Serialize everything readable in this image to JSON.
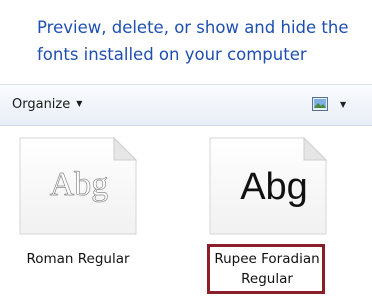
{
  "header": {
    "description": "Preview, delete, or show and hide the fonts installed on your computer"
  },
  "toolbar": {
    "organize_label": "Organize",
    "caret": "▼",
    "view_icon": "change-view-icon"
  },
  "fonts": [
    {
      "sample": "Abg",
      "name": "Roman Regular"
    },
    {
      "sample": "Abg",
      "name_line1": "Rupee Foradian",
      "name_line2": "Regular",
      "highlighted": true
    }
  ],
  "colors": {
    "header_text": "#1e4fb0",
    "highlight_border": "#8b1e28"
  }
}
